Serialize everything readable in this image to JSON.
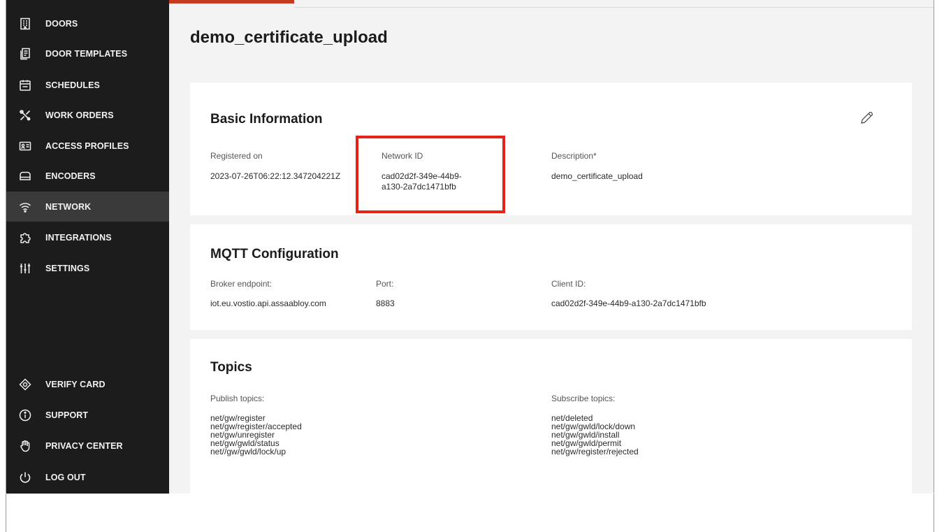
{
  "sidebar": {
    "nav": [
      {
        "label": "DOORS",
        "icon": "building-icon"
      },
      {
        "label": "DOOR TEMPLATES",
        "icon": "templates-icon"
      },
      {
        "label": "SCHEDULES",
        "icon": "calendar-icon"
      },
      {
        "label": "WORK ORDERS",
        "icon": "tools-icon"
      },
      {
        "label": "ACCESS PROFILES",
        "icon": "id-card-icon"
      },
      {
        "label": "ENCODERS",
        "icon": "encoder-icon"
      },
      {
        "label": "NETWORK",
        "icon": "wifi-icon",
        "active": true
      },
      {
        "label": "INTEGRATIONS",
        "icon": "puzzle-icon"
      },
      {
        "label": "SETTINGS",
        "icon": "sliders-icon"
      }
    ],
    "footer": [
      {
        "label": "VERIFY CARD",
        "icon": "verify-card-icon"
      },
      {
        "label": "SUPPORT",
        "icon": "info-icon"
      },
      {
        "label": "PRIVACY CENTER",
        "icon": "hand-icon"
      },
      {
        "label": "LOG OUT",
        "icon": "power-icon"
      }
    ]
  },
  "page": {
    "title": "demo_certificate_upload"
  },
  "basic_info": {
    "title": "Basic Information",
    "registered_label": "Registered on",
    "registered_value": "2023-07-26T06:22:12.347204221Z",
    "network_id_label": "Network ID",
    "network_id_line1": "cad02d2f-349e-44b9-",
    "network_id_line2": "a130-2a7dc1471bfb",
    "description_label": "Description*",
    "description_value": "demo_certificate_upload",
    "edit_icon": "pencil-icon"
  },
  "mqtt": {
    "title": "MQTT Configuration",
    "broker_label": "Broker endpoint:",
    "broker_value": "iot.eu.vostio.api.assaabloy.com",
    "port_label": "Port:",
    "port_value": "8883",
    "client_label": "Client ID:",
    "client_value": "cad02d2f-349e-44b9-a130-2a7dc1471bfb"
  },
  "topics": {
    "title": "Topics",
    "publish_label": "Publish topics:",
    "publish": [
      "net/gw/register",
      "net/gw/register/accepted",
      "net/gw/unregister",
      "net/gw/gwld/status",
      "net//gw/gwld/lock/up"
    ],
    "subscribe_label": "Subscribe topics:",
    "subscribe": [
      "net/deleted",
      "net/gw/gwld/lock/down",
      "net/gw/gwld/install",
      "net/gw/gwld/permit",
      "net/gw/register/rejected"
    ]
  },
  "colors": {
    "sidebar_bg": "#1c1c1c",
    "sidebar_active": "#3a3a3a",
    "accent": "#c83a20",
    "highlight": "#e8221a",
    "main_bg": "#f3f3f3"
  }
}
